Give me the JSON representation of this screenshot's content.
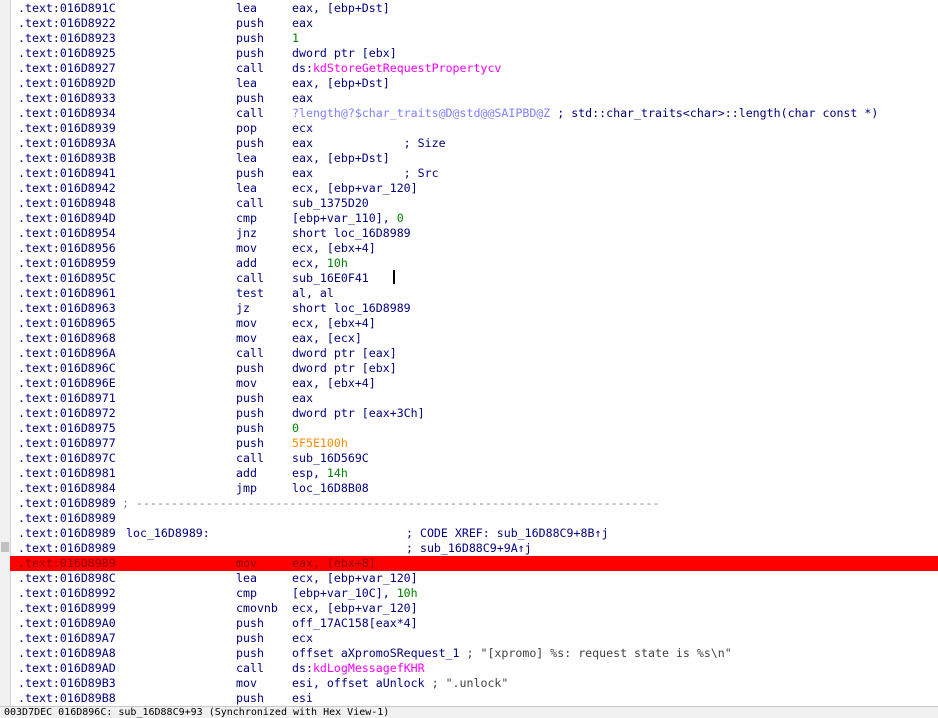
{
  "listing": {
    "lines": [
      {
        "addr": ".text:016D891C",
        "mn": "lea",
        "op": "eax, [ebp+Dst]"
      },
      {
        "addr": ".text:016D8922",
        "mn": "push",
        "op": "eax"
      },
      {
        "addr": ".text:016D8923",
        "mn": "push",
        "op": "1",
        "opc": "num"
      },
      {
        "addr": ".text:016D8925",
        "mn": "push",
        "op": "dword ptr [ebx]"
      },
      {
        "addr": ".text:016D8927",
        "mn": "call",
        "op": "ds:",
        "op2": "kdStoreGetRequestPropertycv",
        "op2c": "imp"
      },
      {
        "addr": ".text:016D892D",
        "mn": "lea",
        "op": "eax, [ebp+Dst]"
      },
      {
        "addr": ".text:016D8933",
        "mn": "push",
        "op": "eax"
      },
      {
        "addr": ".text:016D8934",
        "mn": "call",
        "op": "?length@?$char_traits@D@std@@SAIPBD@Z",
        "opc": "lib",
        "op2": " ; std::char_traits<char>::length(char const *)",
        "op2c": "cmt"
      },
      {
        "addr": ".text:016D8939",
        "mn": "pop",
        "op": "ecx"
      },
      {
        "addr": ".text:016D893A",
        "mn": "push",
        "op": "eax             ; Size"
      },
      {
        "addr": ".text:016D893B",
        "mn": "lea",
        "op": "eax, [ebp+Dst]"
      },
      {
        "addr": ".text:016D8941",
        "mn": "push",
        "op": "eax             ; Src"
      },
      {
        "addr": ".text:016D8942",
        "mn": "lea",
        "op": "ecx, [ebp+var_120]"
      },
      {
        "addr": ".text:016D8948",
        "mn": "call",
        "op": "sub_1375D20"
      },
      {
        "addr": ".text:016D894D",
        "mn": "cmp",
        "op": "[ebp+var_110], ",
        "op2": "0",
        "op2c": "num"
      },
      {
        "addr": ".text:016D8954",
        "mn": "jnz",
        "op": "short loc_16D8989"
      },
      {
        "addr": ".text:016D8956",
        "mn": "mov",
        "op": "ecx, [ebx+4]"
      },
      {
        "addr": ".text:016D8959",
        "mn": "add",
        "op": "ecx, ",
        "op2": "10h",
        "op2c": "num"
      },
      {
        "addr": ".text:016D895C",
        "mn": "call",
        "op": "sub_16E0F41"
      },
      {
        "addr": ".text:016D8961",
        "mn": "test",
        "op": "al, al"
      },
      {
        "addr": ".text:016D8963",
        "mn": "jz",
        "op": "short loc_16D8989"
      },
      {
        "addr": ".text:016D8965",
        "mn": "mov",
        "op": "ecx, [ebx+4]"
      },
      {
        "addr": ".text:016D8968",
        "mn": "mov",
        "op": "eax, [ecx]"
      },
      {
        "addr": ".text:016D896A",
        "mn": "call",
        "op": "dword ptr [eax]"
      },
      {
        "addr": ".text:016D896C",
        "mn": "push",
        "op": "dword ptr [ebx]"
      },
      {
        "addr": ".text:016D896E",
        "mn": "mov",
        "op": "eax, [ebx+4]"
      },
      {
        "addr": ".text:016D8971",
        "mn": "push",
        "op": "eax"
      },
      {
        "addr": ".text:016D8972",
        "mn": "push",
        "op": "dword ptr [eax+3Ch]"
      },
      {
        "addr": ".text:016D8975",
        "mn": "push",
        "op": "0",
        "opc": "num"
      },
      {
        "addr": ".text:016D8977",
        "mn": "push",
        "op": "5F5E100h",
        "opc": "hexc"
      },
      {
        "addr": ".text:016D897C",
        "mn": "call",
        "op": "sub_16D569C"
      },
      {
        "addr": ".text:016D8981",
        "mn": "add",
        "op": "esp, ",
        "op2": "14h",
        "op2c": "num"
      },
      {
        "addr": ".text:016D8984",
        "mn": "jmp",
        "op": "loc_16D8B08"
      },
      {
        "addr": ".text:016D8989",
        "sep": "; ---------------------------------------------------------------------------"
      },
      {
        "addr": ".text:016D8989"
      },
      {
        "addr": ".text:016D8989",
        "lbl": "loc_16D8989:",
        "xref": "; CODE XREF: sub_16D88C9+8B↑j"
      },
      {
        "addr": ".text:016D8989",
        "xref": "; sub_16D88C9+9A↑j"
      },
      {
        "addr": ".text:016D8989",
        "mn": "mov",
        "op": "eax, [ebx+",
        "op2": "8",
        "op2c": "num",
        "op3": "]",
        "hl": true
      },
      {
        "addr": ".text:016D898C",
        "mn": "lea",
        "op": "ecx, [ebp+var_120]"
      },
      {
        "addr": ".text:016D8992",
        "mn": "cmp",
        "op": "[ebp+var_10C], ",
        "op2": "10h",
        "op2c": "num"
      },
      {
        "addr": ".text:016D8999",
        "mn": "cmovnb",
        "op": "ecx, [ebp+var_120]"
      },
      {
        "addr": ".text:016D89A0",
        "mn": "push",
        "op": "off_17AC158[eax*4]"
      },
      {
        "addr": ".text:016D89A7",
        "mn": "push",
        "op": "ecx"
      },
      {
        "addr": ".text:016D89A8",
        "mn": "push",
        "op": "offset aXpromoSRequest_1",
        "op2": " ; \"[xpromo] %s: request state is %s\\n\"",
        "op2c": "str"
      },
      {
        "addr": ".text:016D89AD",
        "mn": "call",
        "op": "ds:",
        "op2": "kdLogMessagefKHR",
        "op2c": "imp"
      },
      {
        "addr": ".text:016D89B3",
        "mn": "mov",
        "op": "esi, offset aUnlock",
        "op2": " ; \".unlock\"",
        "op2c": "str"
      },
      {
        "addr": ".text:016D89B8",
        "mn": "push",
        "op": "esi"
      }
    ]
  },
  "status_bar": {
    "text": "003D7DEC 016D896C: sub_16D88C9+93 (Synchronized with Hex View-1)"
  }
}
